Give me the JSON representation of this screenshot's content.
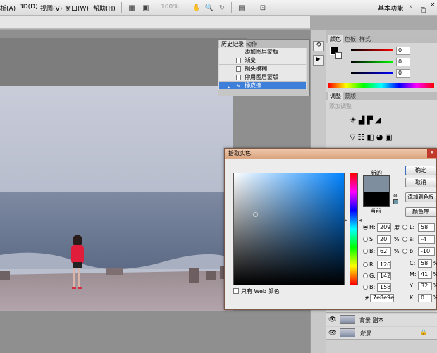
{
  "menubar": {
    "items": [
      "析(A)",
      "3D(D)",
      "视图(V)",
      "窗口(W)",
      "帮助(H)"
    ],
    "zoom": "100%",
    "workspace": "基本功能",
    "window_controls": [
      "_",
      "□",
      "×"
    ]
  },
  "colors_panel": {
    "tabs": [
      "颜色",
      "色板",
      "样式"
    ],
    "values": [
      "0",
      "0",
      "0"
    ]
  },
  "adjust_panel": {
    "tabs": [
      "调整",
      "蒙版"
    ],
    "hint": "添加调整"
  },
  "history": {
    "tabs": [
      "历史记录",
      "动作"
    ],
    "rows": [
      "添加图层蒙版",
      "渐变",
      "镜头模糊",
      "停用图层蒙版",
      "橡皮擦"
    ]
  },
  "picker": {
    "title": "拾取实色:",
    "new_label": "新的",
    "current_label": "当前",
    "buttons": {
      "ok": "确定",
      "cancel": "取消",
      "add_swatch": "添加到色板",
      "library": "颜色库"
    },
    "web_only": "只有 Web 颜色",
    "hsb": [
      {
        "label": "H:",
        "value": "209",
        "unit": "度"
      },
      {
        "label": "S:",
        "value": "20",
        "unit": "%"
      },
      {
        "label": "B:",
        "value": "62",
        "unit": "%"
      }
    ],
    "rgb": [
      {
        "label": "R:",
        "value": "126"
      },
      {
        "label": "G:",
        "value": "142"
      },
      {
        "label": "B:",
        "value": "158"
      }
    ],
    "lab": [
      {
        "label": "L:",
        "value": "58"
      },
      {
        "label": "a:",
        "value": "-4"
      },
      {
        "label": "b:",
        "value": "-10"
      }
    ],
    "cmyk": [
      {
        "label": "C:",
        "value": "58",
        "unit": "%"
      },
      {
        "label": "M:",
        "value": "41",
        "unit": "%"
      },
      {
        "label": "Y:",
        "value": "32",
        "unit": "%"
      },
      {
        "label": "K:",
        "value": "0",
        "unit": "%"
      }
    ],
    "hex_label": "#",
    "hex": "7e8e9e",
    "new_color": "#7e8e9e",
    "current_color": "#000000"
  },
  "layers": {
    "rows": [
      {
        "name": "背景 副本"
      },
      {
        "name": "背景"
      }
    ]
  }
}
